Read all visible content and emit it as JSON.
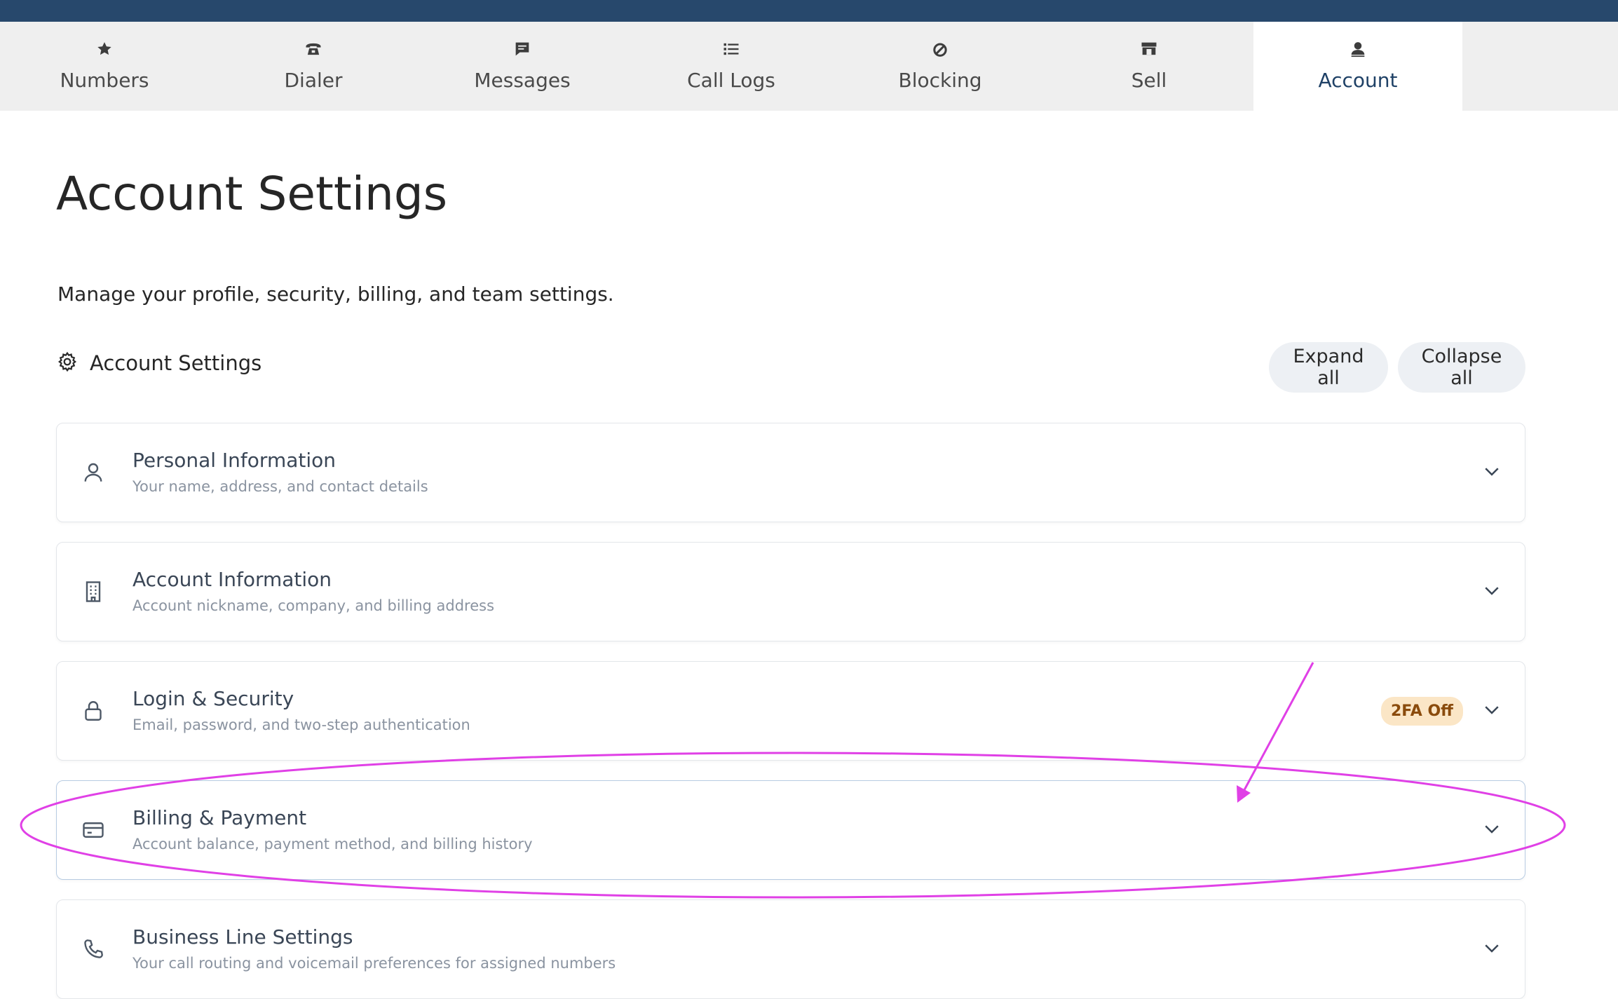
{
  "nav": {
    "tabs": [
      {
        "label": "Numbers",
        "icon": "star-icon"
      },
      {
        "label": "Dialer",
        "icon": "telephone-icon"
      },
      {
        "label": "Messages",
        "icon": "message-icon"
      },
      {
        "label": "Call Logs",
        "icon": "list-icon"
      },
      {
        "label": "Blocking",
        "icon": "block-icon"
      },
      {
        "label": "Sell",
        "icon": "store-icon"
      },
      {
        "label": "Account",
        "icon": "user-icon"
      }
    ],
    "active": "Account"
  },
  "page": {
    "title": "Account Settings",
    "subtitle": "Manage your profile, security, billing, and team settings."
  },
  "section": {
    "label": "Account Settings",
    "icon": "gear-icon",
    "expand_label": "Expand all",
    "collapse_label": "Collapse all"
  },
  "cards": [
    {
      "title": "Personal Information",
      "desc": "Your name, address, and contact details",
      "icon": "person-icon"
    },
    {
      "title": "Account Information",
      "desc": "Account nickname, company, and billing address",
      "icon": "building-icon"
    },
    {
      "title": "Login & Security",
      "desc": "Email, password, and two-step authentication",
      "icon": "lock-icon",
      "badge": "2FA Off"
    },
    {
      "title": "Billing & Payment",
      "desc": "Account balance, payment method, and billing history",
      "icon": "credit-card-icon"
    },
    {
      "title": "Business Line Settings",
      "desc": "Your call routing and voicemail preferences for assigned numbers",
      "icon": "phone-icon"
    }
  ],
  "colors": {
    "topbar": "#27486c",
    "accent": "#1f4166",
    "annotation": "#e040e6",
    "badge_bg": "#fbe6c6",
    "badge_text": "#8a4b0c"
  }
}
